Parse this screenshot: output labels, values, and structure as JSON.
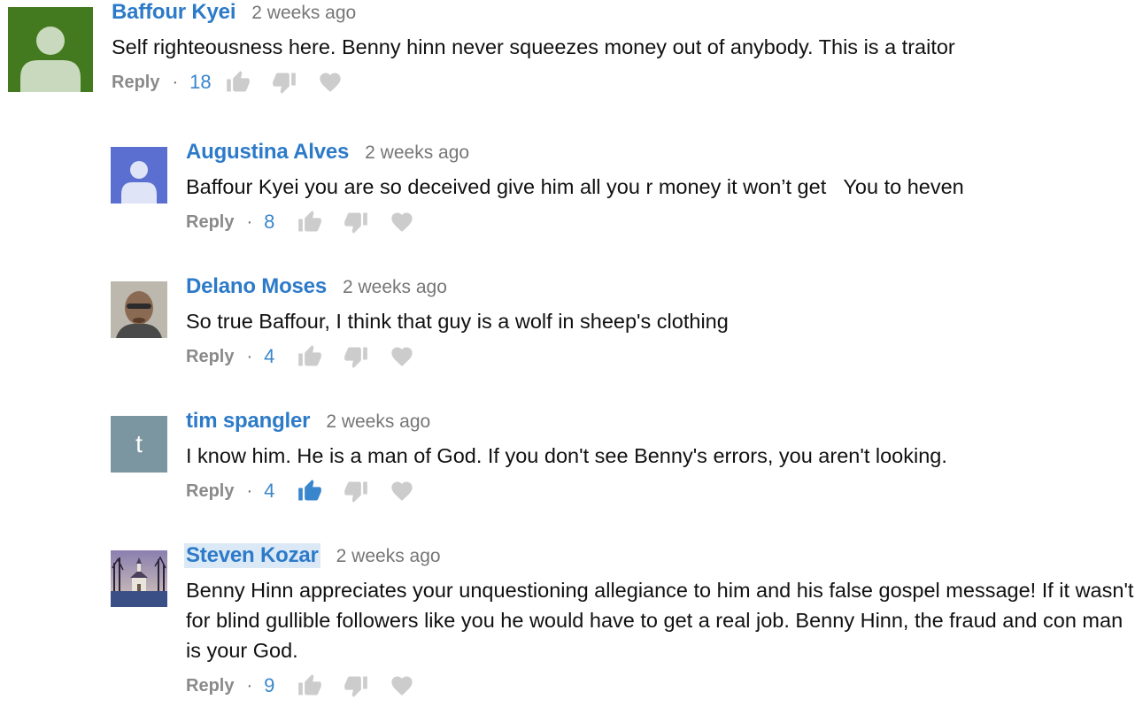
{
  "colors": {
    "author_link": "#2c7ac8",
    "like_count": "#3a86cc",
    "icon_inactive": "#cccccc",
    "icon_active": "#3a86cc",
    "timestamp": "#767676"
  },
  "action_labels": {
    "reply": "Reply",
    "separator": "·"
  },
  "comments": [
    {
      "author": "Baffour Kyei",
      "time": "2 weeks ago",
      "text": "Self righteousness here. Benny hinn never squeezes money out of anybody. This is a traitor",
      "likes": "18",
      "liked": false,
      "avatar": "default-user-avatar-green"
    },
    {
      "author": "Augustina Alves",
      "time": "2 weeks ago",
      "text": "Baffour Kyei you are so deceived give him all you r money it won’t get   You to heven",
      "likes": "8",
      "liked": false,
      "avatar": "default-user-avatar-purple"
    },
    {
      "author": "Delano Moses",
      "time": "2 weeks ago",
      "text": "So true Baffour, I think that guy is a wolf in sheep's clothing",
      "likes": "4",
      "liked": false,
      "avatar": "face-photo-avatar"
    },
    {
      "author": "tim spangler",
      "time": "2 weeks ago",
      "text": "I know him. He is a man of God. If you don't see Benny's errors, you aren't looking.",
      "likes": "4",
      "liked": true,
      "avatar": "letter-avatar",
      "avatar_letter": "t"
    },
    {
      "author": "Steven Kozar",
      "time": "2 weeks ago",
      "text": "Benny Hinn appreciates your unquestioning allegiance to him and his false gospel message! If it wasn't for blind gullible followers like you he would have to get a real job. Benny Hinn, the fraud and con man is your God.",
      "likes": "9",
      "liked": false,
      "avatar": "church-landscape-avatar"
    }
  ]
}
